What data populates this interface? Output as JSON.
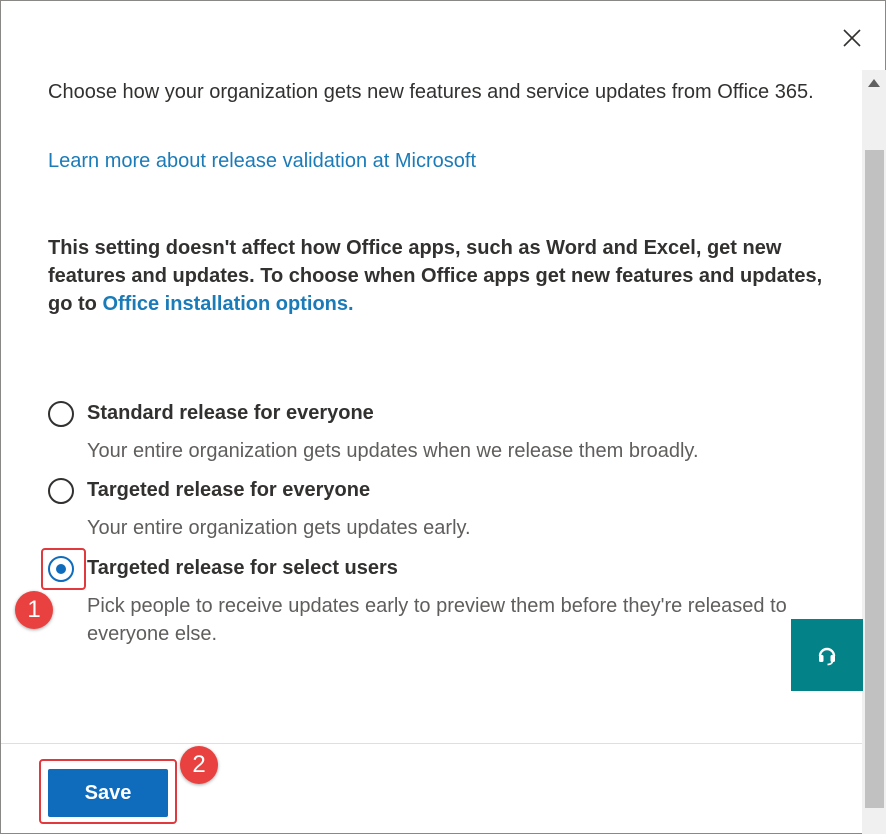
{
  "panel": {
    "intro_text": "Choose how your organization gets new features and service updates from Office 365.",
    "learn_more_link": "Learn more about release validation at Microsoft",
    "note_text": "This setting doesn't affect how Office apps, such as Word and Excel, get new features and updates. To choose when Office apps get new features and updates, go to ",
    "note_link": "Office installation options.",
    "options": [
      {
        "title": "Standard release for everyone",
        "description": "Your entire organization gets updates when we release them broadly.",
        "selected": false
      },
      {
        "title": "Targeted release for everyone",
        "description": "Your entire organization gets updates early.",
        "selected": false
      },
      {
        "title": "Targeted release for select users",
        "description": "Pick people to receive updates early to preview them before they're released to everyone else.",
        "selected": true
      }
    ],
    "save_label": "Save"
  },
  "annotations": {
    "step_1": "1",
    "step_2": "2",
    "color": "#e8413f"
  },
  "icons": {
    "close": "close-icon",
    "help": "headset-icon",
    "scroll_up": "chevron-up-icon"
  },
  "colors": {
    "link": "#1b7bb8",
    "primary": "#0f6cbd",
    "help_fab": "#038387"
  }
}
